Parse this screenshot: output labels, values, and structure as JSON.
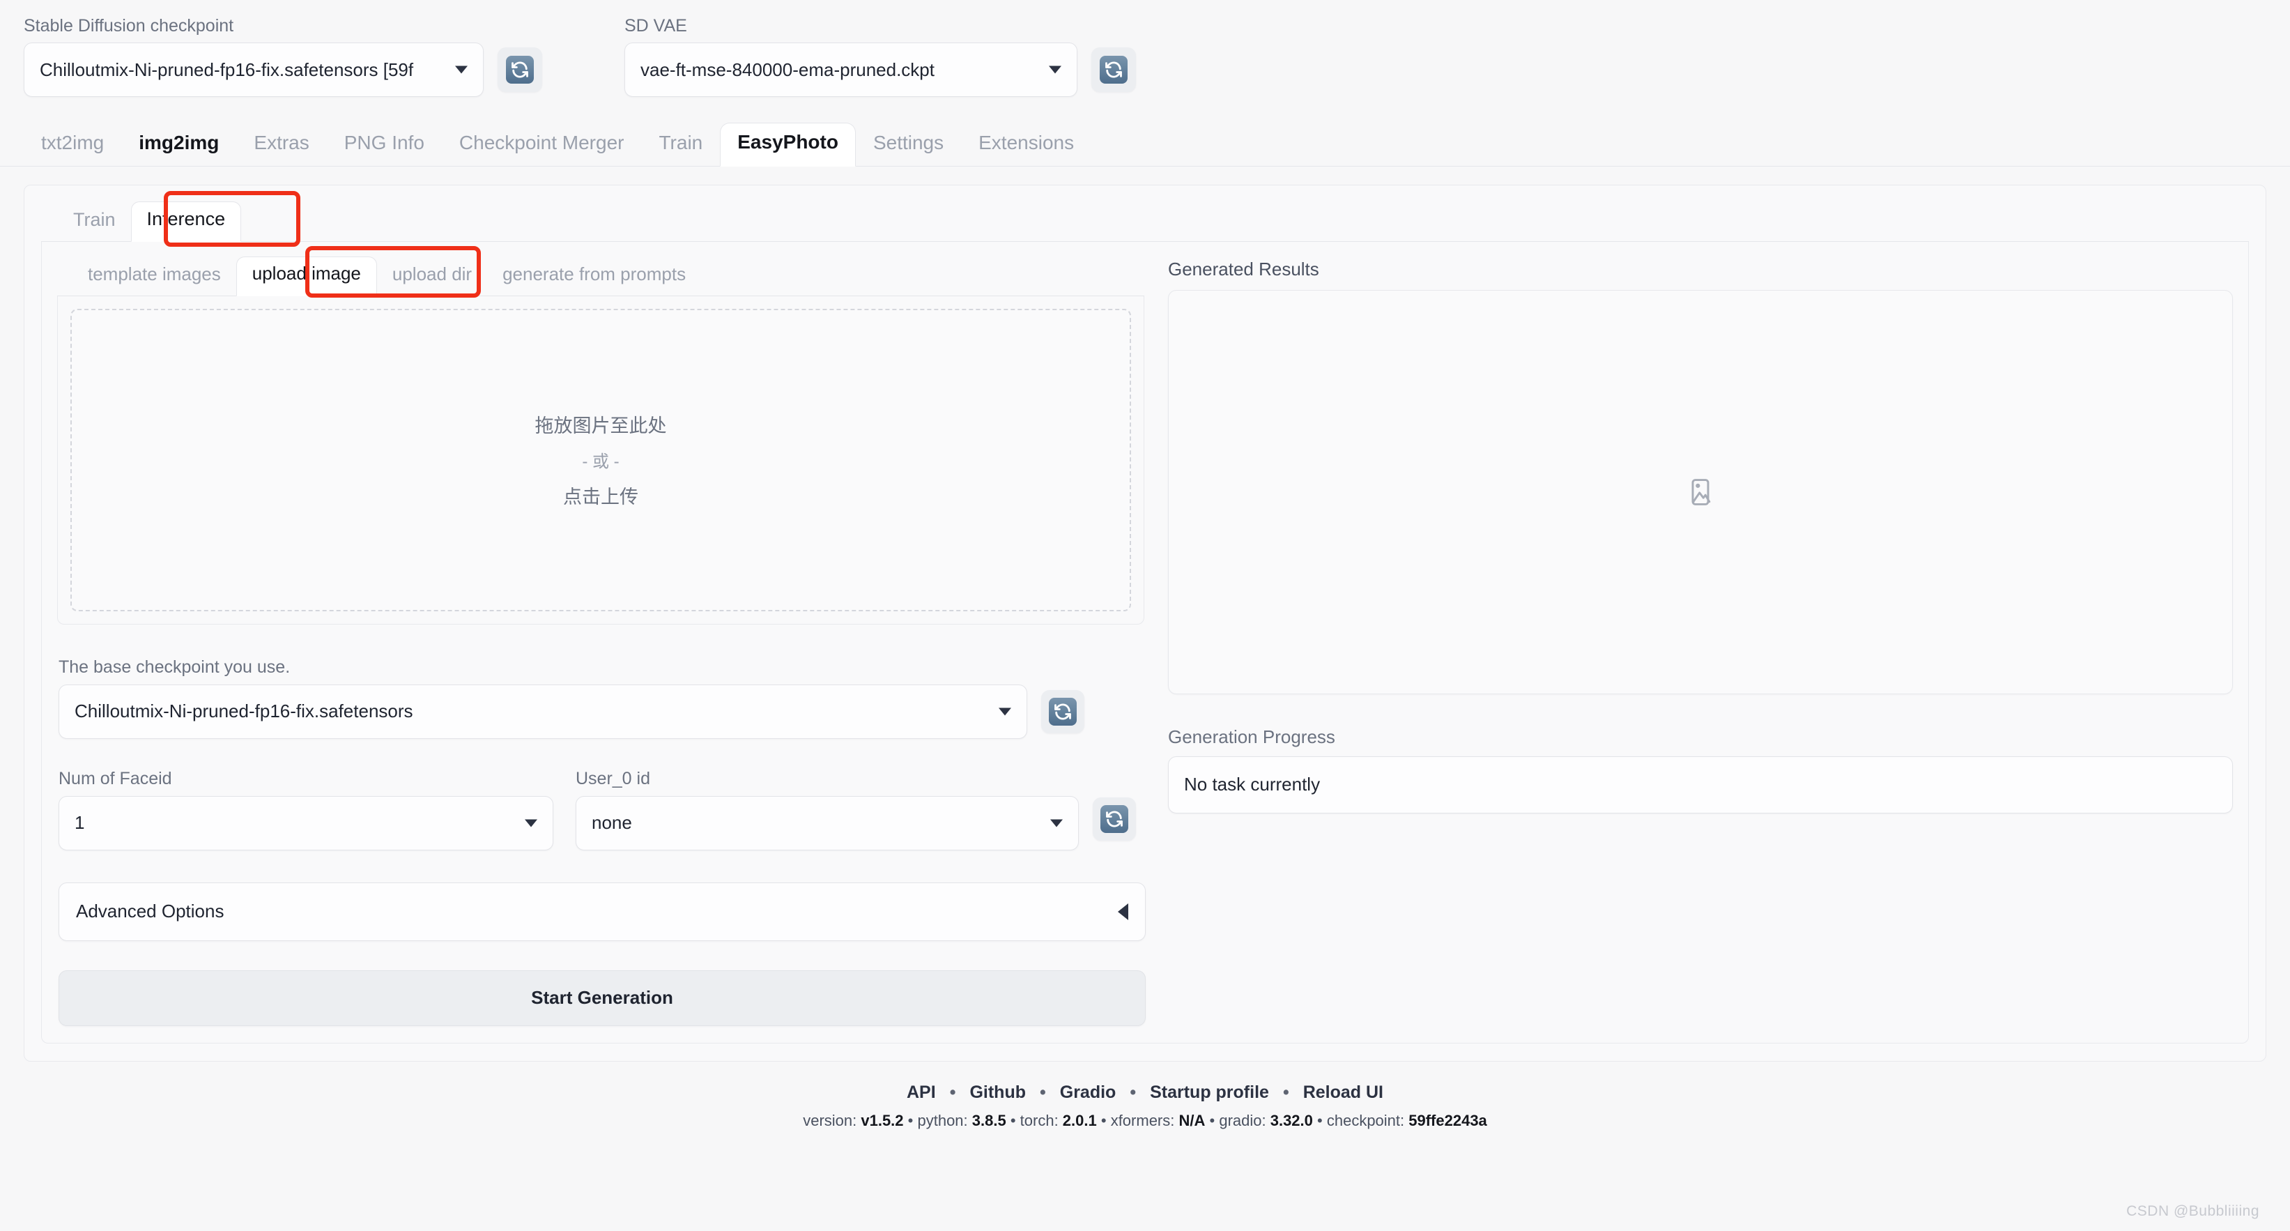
{
  "topbar": {
    "sd_checkpoint": {
      "label": "Stable Diffusion checkpoint",
      "value": "Chilloutmix-Ni-pruned-fp16-fix.safetensors [59f",
      "refresh_icon": "refresh-icon"
    },
    "sd_vae": {
      "label": "SD VAE",
      "value": "vae-ft-mse-840000-ema-pruned.ckpt",
      "refresh_icon": "refresh-icon"
    }
  },
  "main_tabs": [
    {
      "label": "txt2img",
      "selected": false
    },
    {
      "label": "img2img",
      "selected": true
    },
    {
      "label": "Extras",
      "selected": false
    },
    {
      "label": "PNG Info",
      "selected": false
    },
    {
      "label": "Checkpoint Merger",
      "selected": false
    },
    {
      "label": "Train",
      "selected": false
    },
    {
      "label": "EasyPhoto",
      "selected": true
    },
    {
      "label": "Settings",
      "selected": false
    },
    {
      "label": "Extensions",
      "selected": false
    }
  ],
  "sub_tabs": [
    {
      "label": "Train",
      "selected": false
    },
    {
      "label": "Inference",
      "selected": true,
      "annotated": true
    }
  ],
  "image_tabs": [
    {
      "label": "template images",
      "selected": false
    },
    {
      "label": "upload image",
      "selected": true,
      "annotated": true
    },
    {
      "label": "upload dir",
      "selected": false
    },
    {
      "label": "generate from prompts",
      "selected": false
    }
  ],
  "dropzone": {
    "line1": "拖放图片至此处",
    "line2": "- 或 -",
    "line3": "点击上传"
  },
  "form": {
    "base_checkpoint": {
      "label": "The base checkpoint you use.",
      "value": "Chilloutmix-Ni-pruned-fp16-fix.safetensors"
    },
    "num_faceid": {
      "label": "Num of Faceid",
      "value": "1"
    },
    "user_0_id": {
      "label": "User_0 id",
      "value": "none"
    },
    "advanced_options": {
      "label": "Advanced Options",
      "icon": "triangle-left-icon"
    },
    "start_button": {
      "label": "Start Generation"
    }
  },
  "results": {
    "title": "Generated Results",
    "placeholder_icon": "image-placeholder-icon",
    "progress_label": "Generation Progress",
    "progress_value": "No task currently"
  },
  "footer": {
    "links": [
      "API",
      "Github",
      "Gradio",
      "Startup profile",
      "Reload UI"
    ],
    "separator": "•",
    "version_parts": [
      {
        "key": "version: ",
        "val": "v1.5.2"
      },
      {
        "key": "python: ",
        "val": "3.8.5"
      },
      {
        "key": "torch: ",
        "val": "2.0.1"
      },
      {
        "key": "xformers: ",
        "val": "N/A"
      },
      {
        "key": "gradio: ",
        "val": "3.32.0"
      },
      {
        "key": "checkpoint: ",
        "val": "59ffe2243a"
      }
    ]
  },
  "watermark": "CSDN @Bubbliiiing",
  "colors": {
    "annotation_red": "#ef2f18",
    "accent_blue": "#4e6e8c"
  }
}
